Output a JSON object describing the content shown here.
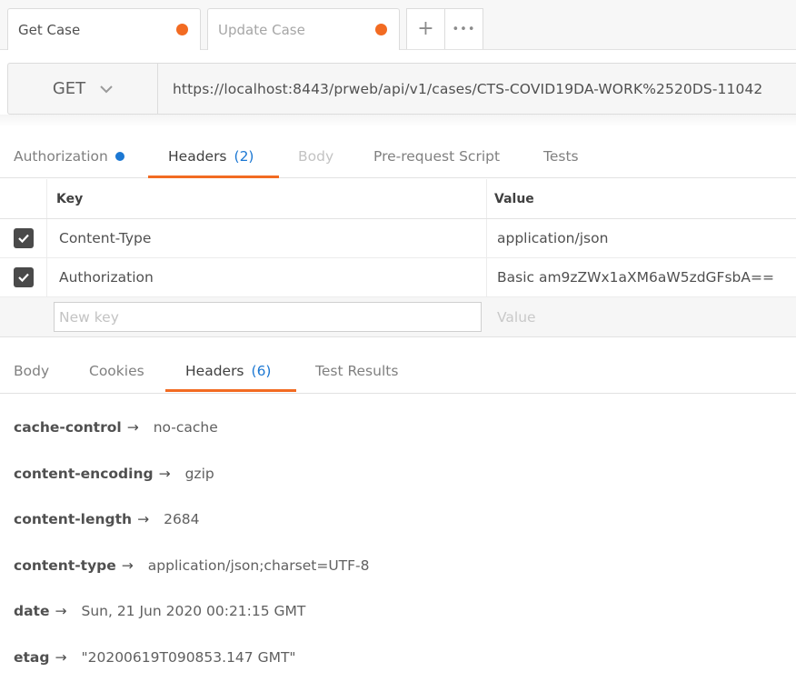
{
  "tabs": [
    {
      "label": "Get Case"
    },
    {
      "label": "Update Case"
    }
  ],
  "tab_actions": {
    "new_tab": "+",
    "more": "•••"
  },
  "request": {
    "method": "GET",
    "url": "https://localhost:8443/prweb/api/v1/cases/CTS-COVID19DA-WORK%2520DS-11042"
  },
  "request_tabs": {
    "authorization": "Authorization",
    "headers": "Headers",
    "headers_count": "(2)",
    "body": "Body",
    "prerequest": "Pre-request Script",
    "tests": "Tests"
  },
  "headers_table": {
    "col_key": "Key",
    "col_value": "Value",
    "rows": [
      {
        "key": "Content-Type",
        "value": "application/json",
        "checked": true
      },
      {
        "key": "Authorization",
        "value": "Basic am9zZWx1aXM6aW5zdGFsbA==",
        "checked": true
      }
    ],
    "new_key_placeholder": "New key",
    "new_value_placeholder": "Value"
  },
  "response_tabs": {
    "body": "Body",
    "cookies": "Cookies",
    "headers": "Headers",
    "headers_count": "(6)",
    "test_results": "Test Results"
  },
  "response_headers": [
    {
      "key": "cache-control",
      "arrow": "→",
      "value": "no-cache"
    },
    {
      "key": "content-encoding",
      "arrow": "→",
      "value": "gzip"
    },
    {
      "key": "content-length",
      "arrow": "→",
      "value": "2684"
    },
    {
      "key": "content-type",
      "arrow": "→",
      "value": "application/json;charset=UTF-8"
    },
    {
      "key": "date",
      "arrow": "→",
      "value": "Sun, 21 Jun 2020 00:21:15 GMT"
    },
    {
      "key": "etag",
      "arrow": "→",
      "value": "\"20200619T090853.147 GMT\""
    }
  ],
  "colors": {
    "accent": "#f26b22",
    "link_blue": "#1c78d3"
  }
}
